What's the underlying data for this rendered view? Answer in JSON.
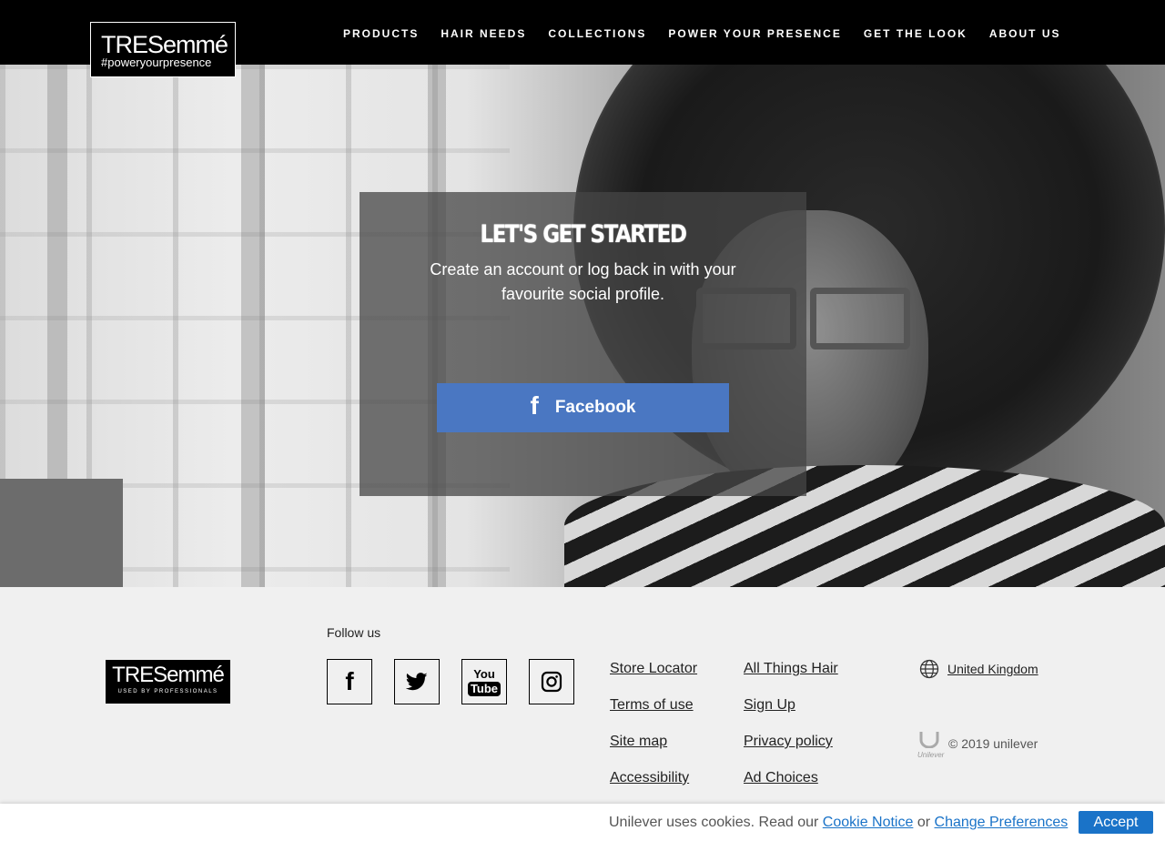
{
  "header": {
    "logo": {
      "main": "TRESemmé",
      "tagline": "#poweryourpresence"
    },
    "nav": [
      {
        "label": "PRODUCTS"
      },
      {
        "label": "HAIR NEEDS"
      },
      {
        "label": "COLLECTIONS"
      },
      {
        "label": "POWER YOUR PRESENCE"
      },
      {
        "label": "GET THE LOOK"
      },
      {
        "label": "ABOUT US"
      }
    ]
  },
  "login": {
    "title": "LET'S GET STARTED",
    "text": "Create an account or log back in with your favourite social profile.",
    "facebook_button": {
      "icon": "f",
      "label": "Facebook",
      "color": "#4a77c2"
    }
  },
  "footer": {
    "logo": {
      "main": "TRESemmé",
      "sub": "USED BY PROFESSIONALS"
    },
    "follow_label": "Follow us",
    "social": [
      {
        "name": "facebook-icon",
        "glyph": "f"
      },
      {
        "name": "twitter-icon"
      },
      {
        "name": "youtube-icon",
        "top": "You",
        "bottom": "Tube"
      },
      {
        "name": "instagram-icon"
      }
    ],
    "links_col1": [
      "Store Locator",
      "Terms of use",
      "Site map",
      "Accessibility"
    ],
    "links_col2": [
      "All Things Hair",
      "Sign Up",
      "Privacy policy",
      "Ad Choices"
    ],
    "country": "United Kingdom",
    "unilever_mark": "Unilever",
    "copyright": "© 2019 unilever"
  },
  "cookie_bar": {
    "text_before": "Unilever uses cookies. Read our ",
    "cookie_notice": "Cookie Notice",
    "text_middle": " or ",
    "change_preferences": "Change Preferences",
    "accept": "Accept",
    "accent": "#1a73c8"
  }
}
